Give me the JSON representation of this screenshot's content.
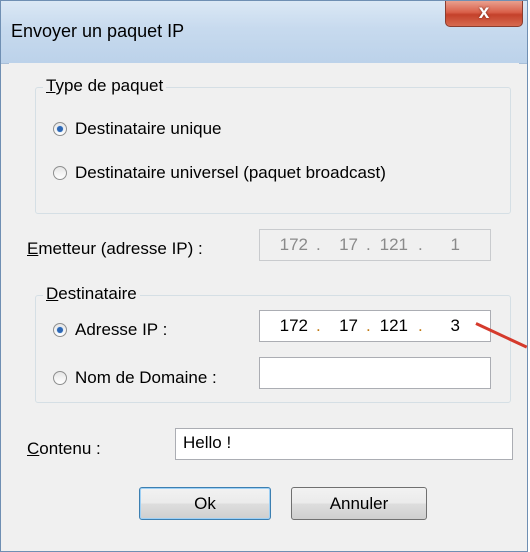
{
  "window": {
    "title": "Envoyer un paquet IP",
    "close_label": "x"
  },
  "packet_type": {
    "legend_prefix": "T",
    "legend_rest": "ype de paquet",
    "options": [
      {
        "label": "Destinataire unique",
        "checked": true
      },
      {
        "label": "Destinataire universel (paquet broadcast)",
        "checked": false
      }
    ]
  },
  "sender": {
    "label_prefix": "E",
    "label_rest": "metteur (adresse IP) :",
    "ip": [
      "172",
      "17",
      "121",
      "1"
    ]
  },
  "recipient": {
    "legend_prefix": "D",
    "legend_rest": "estinataire",
    "ip_option": {
      "label": "Adresse IP :",
      "checked": true
    },
    "ip": [
      "172",
      "17",
      "121",
      "3"
    ],
    "domain_option": {
      "label": "Nom de Domaine :",
      "checked": false
    },
    "domain_value": ""
  },
  "content": {
    "label_prefix": "C",
    "label_rest": "ontenu :",
    "value": "Hello !"
  },
  "buttons": {
    "ok": "Ok",
    "cancel": "Annuler"
  },
  "colors": {
    "annotation_arrow": "#d53a2c",
    "radio_dot": "#2d67b4"
  }
}
